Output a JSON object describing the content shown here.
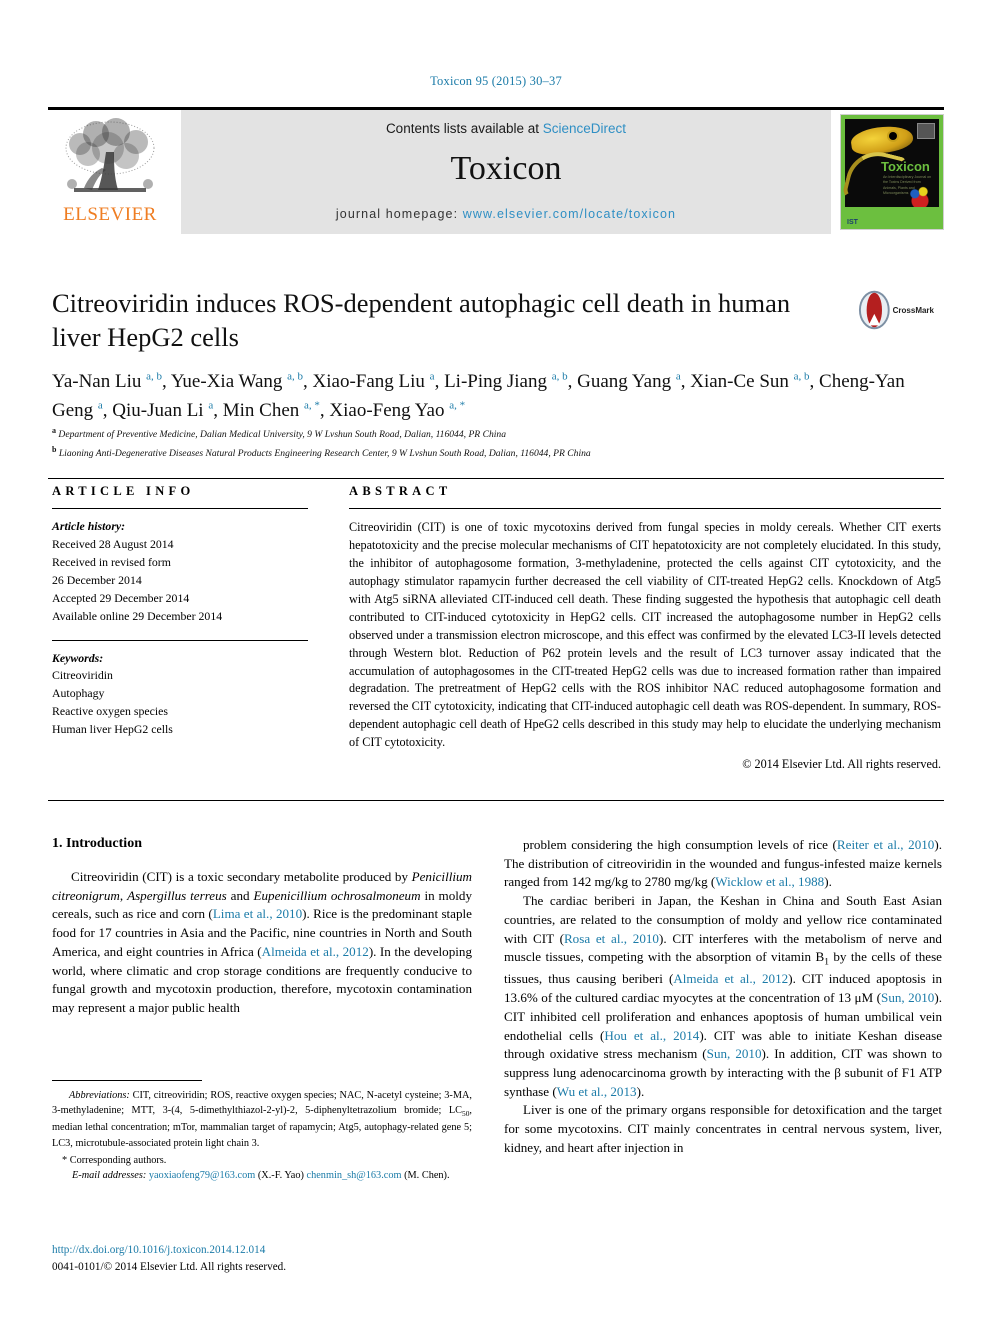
{
  "running_head": "Toxicon 95 (2015) 30–37",
  "masthead": {
    "publisher_logo_text": "ELSEVIER",
    "contents_prefix": "Contents lists available at ",
    "contents_link": "ScienceDirect",
    "journal_name": "Toxicon",
    "homepage_prefix": "journal homepage: ",
    "homepage_url": "www.elsevier.com/locate/toxicon",
    "cover": {
      "title": "Toxicon",
      "subtitle": "An Interdisciplinary Journal on the Toxins Derived from Animals, Plants and Microorganisms",
      "footer": "IST"
    }
  },
  "article": {
    "title": "Citreoviridin induces ROS-dependent autophagic cell death in human liver HepG2 cells",
    "crossmark_label": "CrossMark",
    "authors": [
      {
        "name": "Ya-Nan Liu",
        "marks": "a, b",
        "sep": ", "
      },
      {
        "name": "Yue-Xia Wang",
        "marks": "a, b",
        "sep": ", "
      },
      {
        "name": "Xiao-Fang Liu",
        "marks": "a",
        "sep": ", "
      },
      {
        "name": "Li-Ping Jiang",
        "marks": "a, b",
        "sep": ", "
      },
      {
        "name": "Guang Yang",
        "marks": "a",
        "sep": ", "
      },
      {
        "name": "Xian-Ce Sun",
        "marks": "a, b",
        "sep": ", "
      },
      {
        "name": "Cheng-Yan Geng",
        "marks": "a",
        "sep": ", "
      },
      {
        "name": "Qiu-Juan Li",
        "marks": "a",
        "sep": ", "
      },
      {
        "name": "Min Chen",
        "marks": "a, *",
        "sep": ", "
      },
      {
        "name": "Xiao-Feng Yao",
        "marks": "a, *",
        "sep": ""
      }
    ],
    "affiliations": [
      {
        "mark": "a",
        "text": "Department of Preventive Medicine, Dalian Medical University, 9 W Lvshun South Road, Dalian, 116044, PR China"
      },
      {
        "mark": "b",
        "text": "Liaoning Anti-Degenerative Diseases Natural Products Engineering Research Center, 9 W Lvshun South Road, Dalian, 116044, PR China"
      }
    ]
  },
  "article_info": {
    "heading": "ARTICLE INFO",
    "history_label": "Article history:",
    "history": [
      "Received 28 August 2014",
      "Received in revised form",
      "26 December 2014",
      "Accepted 29 December 2014",
      "Available online 29 December 2014"
    ],
    "keywords_label": "Keywords:",
    "keywords": [
      "Citreoviridin",
      "Autophagy",
      "Reactive oxygen species",
      "Human liver HepG2 cells"
    ]
  },
  "abstract": {
    "heading": "ABSTRACT",
    "text": "Citreoviridin (CIT) is one of toxic mycotoxins derived from fungal species in moldy cereals. Whether CIT exerts hepatotoxicity and the precise molecular mechanisms of CIT hepatotoxicity are not completely elucidated. In this study, the inhibitor of autophagosome formation, 3-methyladenine, protected the cells against CIT cytotoxicity, and the autophagy stimulator rapamycin further decreased the cell viability of CIT-treated HepG2 cells. Knockdown of Atg5 with Atg5 siRNA alleviated CIT-induced cell death. These finding suggested the hypothesis that autophagic cell death contributed to CIT-induced cytotoxicity in HepG2 cells. CIT increased the autophagosome number in HepG2 cells observed under a transmission electron microscope, and this effect was confirmed by the elevated LC3-II levels detected through Western blot. Reduction of P62 protein levels and the result of LC3 turnover assay indicated that the accumulation of autophagosomes in the CIT-treated HepG2 cells was due to increased formation rather than impaired degradation. The pretreatment of HepG2 cells with the ROS inhibitor NAC reduced autophagosome formation and reversed the CIT cytotoxicity, indicating that CIT-induced autophagic cell death was ROS-dependent. In summary, ROS-dependent autophagic cell death of HpeG2 cells described in this study may help to elucidate the underlying mechanism of CIT cytotoxicity.",
    "copyright": "© 2014 Elsevier Ltd. All rights reserved."
  },
  "body": {
    "section_heading": "1. Introduction",
    "left_paragraphs": [
      "Citreoviridin (CIT) is a toxic secondary metabolite produced by <i>Penicillium citreonigrum</i>, <i>Aspergillus terreus</i> and <i>Eupenicillium ochrosalmoneum</i> in moldy cereals, such as rice and corn (<a class=\"link\">Lima et al., 2010</a>). Rice is the predominant staple food for 17 countries in Asia and the Pacific, nine countries in North and South America, and eight countries in Africa (<a class=\"link\">Almeida et al., 2012</a>). In the developing world, where climatic and crop storage conditions are frequently conducive to fungal growth and mycotoxin production, therefore, mycotoxin contamination may represent a major public health"
    ],
    "right_paragraphs": [
      "problem considering the high consumption levels of rice (<a class=\"link\">Reiter et al., 2010</a>). The distribution of citreoviridin in the wounded and fungus-infested maize kernels ranged from 142 mg/kg to 2780 mg/kg (<a class=\"link\">Wicklow et al., 1988</a>).",
      "The cardiac beriberi in Japan, the Keshan in China and South East Asian countries, are related to the consumption of moldy and yellow rice contaminated with CIT (<a class=\"link\">Rosa et al., 2010</a>). CIT interferes with the metabolism of nerve and muscle tissues, competing with the absorption of vitamin B<sub>1</sub> by the cells of these tissues, thus causing beriberi (<a class=\"link\">Almeida et al., 2012</a>). CIT induced apoptosis in 13.6% of the cultured cardiac myocytes at the concentration of 13 μM (<a class=\"link\">Sun, 2010</a>). CIT inhibited cell proliferation and enhances apoptosis of human umbilical vein endothelial cells (<a class=\"link\">Hou et al., 2014</a>). CIT was able to initiate Keshan disease through oxidative stress mechanism (<a class=\"link\">Sun, 2010</a>). In addition, CIT was shown to suppress lung adenocarcinoma growth by interacting with the β subunit of F1 ATP synthase (<a class=\"link\">Wu et al., 2013</a>).",
      "Liver is one of the primary organs responsible for detoxification and the target for some mycotoxins. CIT mainly concentrates in central nervous system, liver, kidney, and heart after injection in"
    ]
  },
  "footnotes": {
    "abbreviations": "<i>Abbreviations:</i> CIT, citreoviridin; ROS, reactive oxygen species; NAC, N-acetyl cysteine; 3-MA, 3-methyladenine; MTT, 3-(4, 5-dimethylthiazol-2-yl)-2, 5-diphenyltetrazolium bromide; LC<sub>50</sub>, median lethal concentration; mTor, mammalian target of rapamycin; Atg5, autophagy-related gene 5; LC3, microtubule-associated protein light chain 3.",
    "corresponding": "* Corresponding authors.",
    "email_label": "E-mail addresses:",
    "emails": [
      {
        "address": "yaoxiaofeng79@163.com",
        "owner": "(X.-F. Yao)"
      },
      {
        "address": "chenmin_sh@163.com",
        "owner": "(M. Chen)."
      }
    ],
    "doi": "http://dx.doi.org/10.1016/j.toxicon.2014.12.014",
    "issn_line": "0041-0101/© 2014 Elsevier Ltd. All rights reserved."
  },
  "colors": {
    "link": "#1b7ba8",
    "elsevier_orange": "#ef7d22",
    "band_gray": "#e3e3e3",
    "cover_green": "#6cbf3f"
  }
}
